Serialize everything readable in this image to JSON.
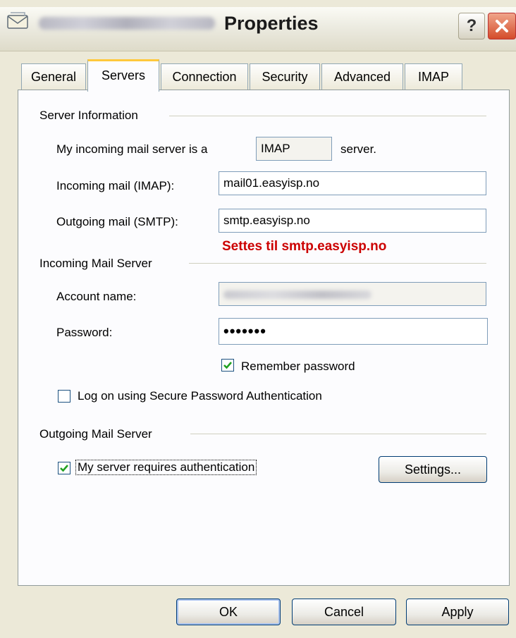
{
  "window": {
    "title": "Properties",
    "help_glyph": "?",
    "close_glyph": "✕"
  },
  "tabs": [
    {
      "label": "General"
    },
    {
      "label": "Servers"
    },
    {
      "label": "Connection"
    },
    {
      "label": "Security"
    },
    {
      "label": "Advanced"
    },
    {
      "label": "IMAP"
    }
  ],
  "server_info": {
    "group_label": "Server Information",
    "incoming_type_prefix": "My incoming mail server is a",
    "incoming_type_value": "IMAP",
    "incoming_type_suffix": "server.",
    "incoming_label": "Incoming mail (IMAP):",
    "incoming_value": "mail01.easyisp.no",
    "outgoing_label": "Outgoing mail (SMTP):",
    "outgoing_value": "smtp.easyisp.no",
    "annotation": "Settes til smtp.easyisp.no"
  },
  "incoming_server": {
    "group_label": "Incoming Mail Server",
    "account_label": "Account name:",
    "password_label": "Password:",
    "password_value": "•••••••",
    "remember_label": "Remember password",
    "remember_checked": true,
    "spa_label": "Log on using Secure Password Authentication",
    "spa_checked": false
  },
  "outgoing_server": {
    "group_label": "Outgoing Mail Server",
    "auth_label": "My server requires authentication",
    "auth_checked": true,
    "settings_label": "Settings..."
  },
  "footer": {
    "ok_label": "OK",
    "cancel_label": "Cancel",
    "apply_label": "Apply"
  },
  "colors": {
    "annotation": "#cc0000",
    "checkmark": "#21a121",
    "active_tab_accent": "#ffc83c"
  },
  "icons": {
    "title": "mail-envelope-icon",
    "check": "checkmark-icon"
  }
}
